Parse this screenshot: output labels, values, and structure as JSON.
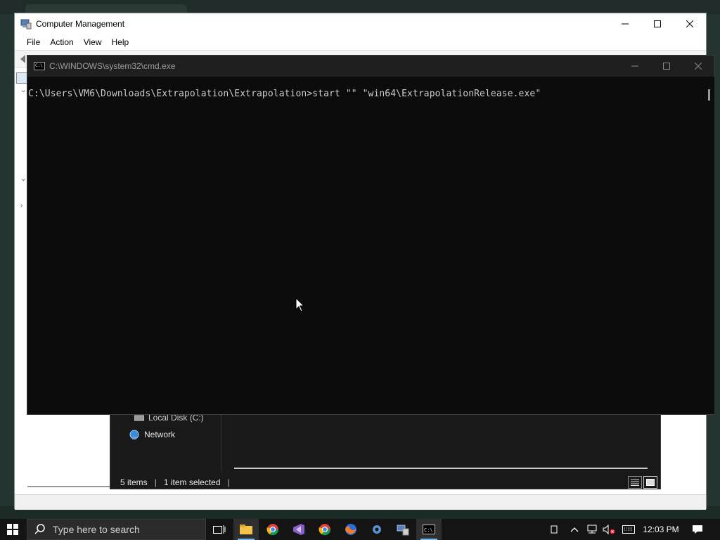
{
  "computer_management": {
    "title": "Computer Management",
    "menu": [
      "File",
      "Action",
      "View",
      "Help"
    ]
  },
  "explorer": {
    "nav_items": {
      "local_disk": "Local Disk (C:)",
      "network": "Network"
    },
    "status": {
      "items_count": "5 items",
      "selection": "1 item selected"
    }
  },
  "cmd": {
    "title": "C:\\WINDOWS\\system32\\cmd.exe",
    "prompt_line": "C:\\Users\\VM6\\Downloads\\Extrapolation\\Extrapolation>start \"\" \"win64\\ExtrapolationRelease.exe\""
  },
  "taskbar": {
    "search_placeholder": "Type here to search",
    "clock": "12:03 PM",
    "apps": [
      "task-view",
      "file-explorer",
      "chrome",
      "visual-studio",
      "chrome-alt",
      "firefox",
      "settings",
      "computer-management",
      "command-prompt"
    ]
  },
  "colors": {
    "accent": "#76b9ed",
    "cmd_background": "#0c0c0c",
    "cmd_text": "#cccccc",
    "taskbar": "#141414"
  }
}
